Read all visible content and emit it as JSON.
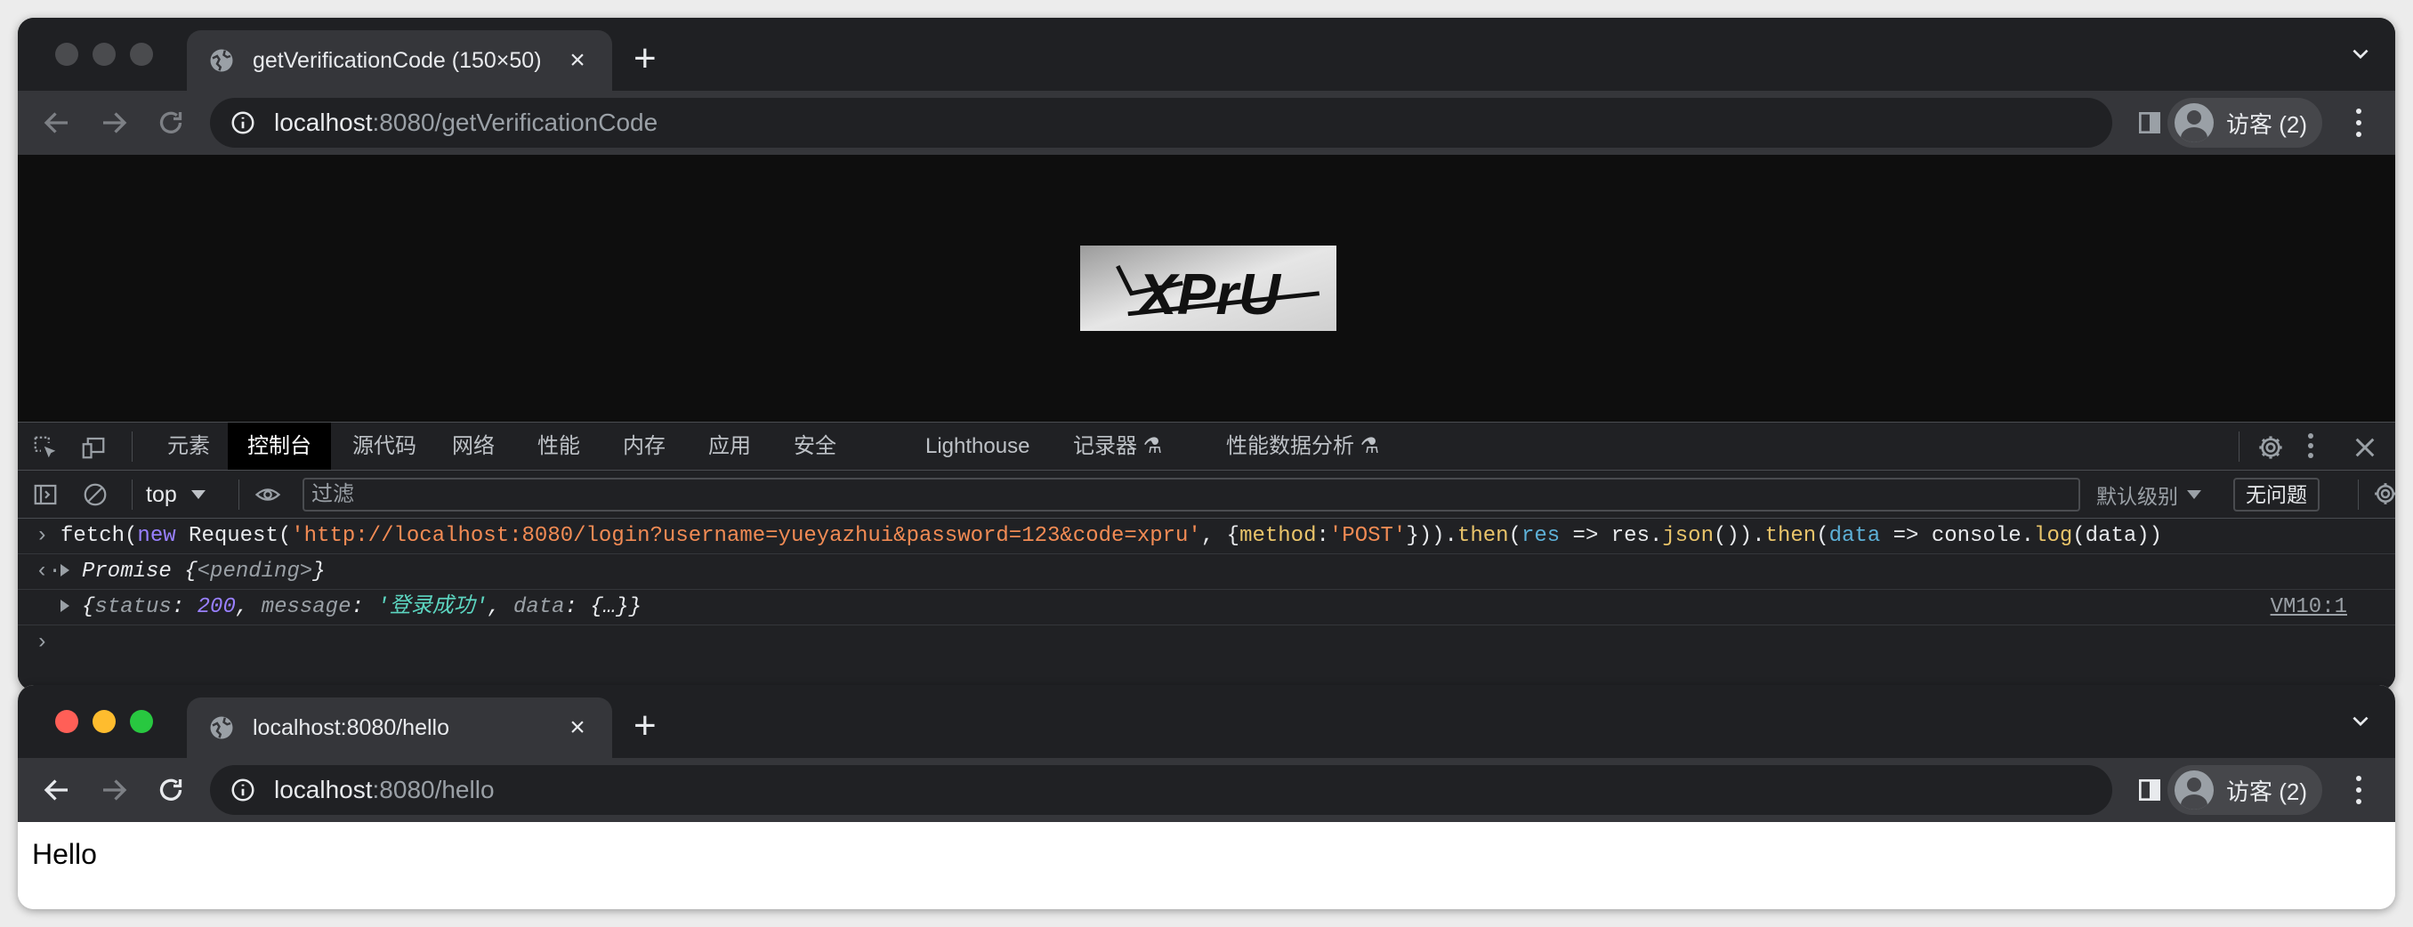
{
  "window1": {
    "tab": {
      "title": "getVerificationCode (150×50)"
    },
    "address": {
      "host": "localhost",
      "path": ":8080/getVerificationCode"
    },
    "profile": {
      "label": "访客 (2)"
    },
    "captcha": {
      "text": "XPrU"
    },
    "devtools": {
      "tabs": [
        "元素",
        "控制台",
        "源代码",
        "网络",
        "性能",
        "内存",
        "应用",
        "安全",
        "Lighthouse",
        "记录器",
        "性能数据分析"
      ],
      "active_tab": "控制台",
      "context": "top",
      "filter_placeholder": "过滤",
      "levels": "默认级别",
      "issues": "无问题",
      "console": {
        "input": {
          "fn": "fetch(",
          "kw": "new",
          "ctor": " Request(",
          "url": "'http://localhost:8080/login?username=yueyazhui&password=123&code=xpru'",
          "mid": ", {",
          "key": "method",
          "colon": ":",
          "method": "'POST'",
          "close1": "})).",
          "then1": "then",
          "paren1": "(",
          "arg1": "res",
          "arrow1": " => res.",
          "json": "json",
          "close2": "()).",
          "then2": "then",
          "paren2": "(",
          "arg2": "data",
          "arrow2": " => console.",
          "log": "log",
          "tail": "(data))"
        },
        "promise": {
          "label": "Promise",
          "open": " {",
          "state": "<pending>",
          "close": "}"
        },
        "result": {
          "open": "{",
          "status_key": "status",
          "status_val": "200",
          "message_key": "message",
          "message_val": "'登录成功'",
          "data_key": "data",
          "data_val": "{…}",
          "close": "}",
          "source": "VM10:1"
        },
        "prompt": "›"
      }
    }
  },
  "window2": {
    "tab": {
      "title": "localhost:8080/hello"
    },
    "address": {
      "host": "localhost",
      "path": ":8080/hello"
    },
    "profile": {
      "label": "访客 (2)"
    },
    "content": {
      "text": "Hello"
    }
  },
  "colors": {
    "chrome_dark": "#35363a",
    "tab_strip": "#1f2023",
    "devtools_bg": "#202124",
    "string": "#f28b54",
    "keyword": "#9980ff",
    "param": "#5db0d7",
    "method": "#e9c46a"
  }
}
